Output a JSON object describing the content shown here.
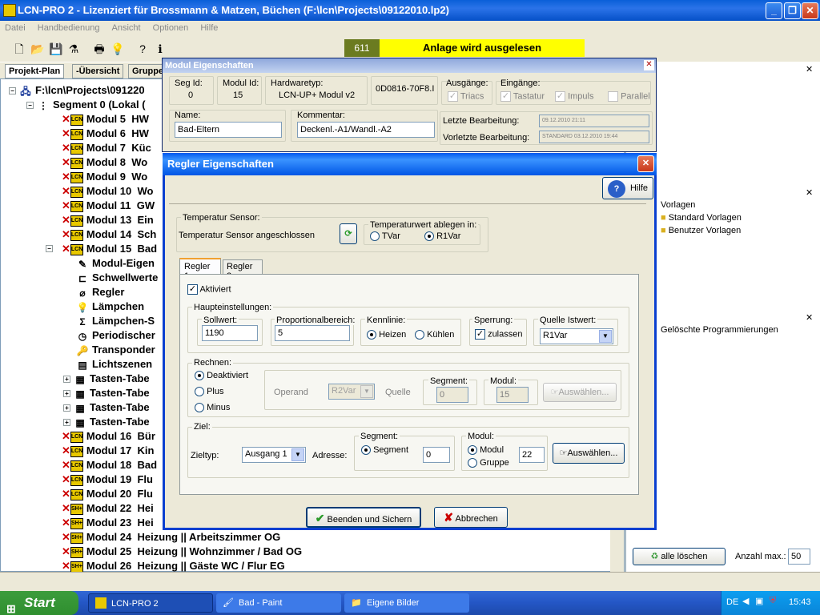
{
  "app": {
    "title": "LCN-PRO 2 - Lizenziert für Brossmann & Matzen, Büchen (F:\\lcn\\Projects\\09122010.lp2)"
  },
  "menu": [
    "Datei",
    "Handbedienung",
    "Ansicht",
    "Optionen",
    "Hilfe"
  ],
  "status": {
    "code": "611",
    "message": "Anlage wird ausgelesen"
  },
  "left_tabs": [
    "Projekt-Plan",
    "-Übersicht",
    "Gruppen"
  ],
  "tree": {
    "root": "F:\\lcn\\Projects\\091220",
    "segment": "Segment 0 (Lokal (",
    "modules_top": [
      {
        "num": "Modul 5",
        "name": "HW"
      },
      {
        "num": "Modul 6",
        "name": "HW"
      },
      {
        "num": "Modul 7",
        "name": "Küc"
      },
      {
        "num": "Modul 8",
        "name": "Wo"
      },
      {
        "num": "Modul 9",
        "name": "Wo"
      },
      {
        "num": "Modul 10",
        "name": "Wo"
      },
      {
        "num": "Modul 11",
        "name": "GW"
      },
      {
        "num": "Modul 13",
        "name": "Ein"
      },
      {
        "num": "Modul 14",
        "name": "Sch"
      },
      {
        "num": "Modul 15",
        "name": "Bad"
      }
    ],
    "children": [
      "Modul-Eigen",
      "Schwellwerte",
      "Regler",
      "Lämpchen",
      "Lämpchen-S",
      "Periodischer",
      "Transponder",
      "Lichtszenen",
      "Tasten-Tabe",
      "Tasten-Tabe",
      "Tasten-Tabe",
      "Tasten-Tabe"
    ],
    "modules_bottom": [
      {
        "num": "Modul 16",
        "name": "Bür",
        "icon": "LCN"
      },
      {
        "num": "Modul 17",
        "name": "Kin",
        "icon": "LCN"
      },
      {
        "num": "Modul 18",
        "name": "Bad",
        "icon": "LCN"
      },
      {
        "num": "Modul 19",
        "name": "Flu",
        "icon": "LCN"
      },
      {
        "num": "Modul 20",
        "name": "Flu",
        "icon": "LCN"
      },
      {
        "num": "Modul 22",
        "name": "Hei",
        "icon": "SH+"
      },
      {
        "num": "Modul 23",
        "name": "Hei",
        "icon": "SH+"
      },
      {
        "num": "Modul 24",
        "name": "Heizung || Arbeitszimmer OG",
        "icon": "SH+"
      },
      {
        "num": "Modul 25",
        "name": "Heizung || Wohnzimmer / Bad OG",
        "icon": "SH+"
      },
      {
        "num": "Modul 26",
        "name": "Heizung || Gäste WC / Flur EG",
        "icon": "SH+"
      }
    ]
  },
  "right_pane": {
    "vorlagen": "Vorlagen",
    "standard": "Standard Vorlagen",
    "benutzer": "Benutzer Vorlagen",
    "geloeschte": "Gelöschte Programmierungen",
    "alle_loeschen": "alle löschen",
    "anzahl_label": "Anzahl max.:",
    "anzahl_value": "50"
  },
  "modul_window": {
    "title": "Modul Eigenschaften",
    "seg_label": "Seg Id:",
    "seg_value": "0",
    "modul_label": "Modul Id:",
    "modul_value": "15",
    "hw_label": "Hardwaretyp:",
    "hw_value": "LCN-UP+ Modul v2",
    "serial": "0D0816-70F8.I",
    "ausgaenge": "Ausgänge:",
    "triacs": "Triacs",
    "eingaenge": "Eingänge:",
    "tastatur": "Tastatur",
    "impuls": "Impuls",
    "parallel": "Parallel",
    "name_label": "Name:",
    "name_value": "Bad-Eltern",
    "kommentar_label": "Kommentar:",
    "kommentar_value": "Deckenl.-A1/Wandl.-A2",
    "letzte_label": "Letzte Bearbeitung:",
    "letzte_value": "09.12.2010 21:11",
    "vorletzte_label": "Vorletzte Bearbeitung:",
    "vorletzte_value": "STANDARD 03.12.2010 19:44"
  },
  "dialog": {
    "title": "Regler Eigenschaften",
    "hilfe": "Hilfe",
    "sensor_group": "Temperatur Sensor:",
    "sensor_status": "Temperatur Sensor angeschlossen",
    "ablegen_group": "Temperaturwert ablegen in:",
    "tvar": "TVar",
    "r1var": "R1Var",
    "tabs": [
      "Regler 1",
      "Regler 2"
    ],
    "aktiviert": "Aktiviert",
    "haupt_group": "Haupteinstellungen:",
    "sollwert_label": "Sollwert:",
    "sollwert_value": "1190",
    "prop_label": "Proportionalbereich:",
    "prop_value": "5",
    "kennlinie_label": "Kennlinie:",
    "heizen": "Heizen",
    "kuehlen": "Kühlen",
    "sperrung_label": "Sperrung:",
    "zulassen": "zulassen",
    "quelle_label": "Quelle Istwert:",
    "quelle_value": "R1Var",
    "rechnen_group": "Rechnen:",
    "deaktiviert": "Deaktiviert",
    "plus": "Plus",
    "minus": "Minus",
    "operand_label": "Operand",
    "operand_value": "R2Var",
    "quelle2_label": "Quelle",
    "segment_label": "Segment:",
    "segment_value": "0",
    "modul_label": "Modul:",
    "modul_value": "15",
    "auswaehlen": "Auswählen...",
    "ziel_group": "Ziel:",
    "zieltyp_label": "Zieltyp:",
    "zieltyp_value": "Ausgang 1",
    "adresse_label": "Adresse:",
    "ziel_segment_group": "Segment:",
    "ziel_segment_radio": "Segment",
    "ziel_segment_value": "0",
    "ziel_modul_group": "Modul:",
    "ziel_modul_radio": "Modul",
    "ziel_gruppe_radio": "Gruppe",
    "ziel_modul_value": "22",
    "ziel_auswaehlen": "Auswählen...",
    "beenden": "Beenden und Sichern",
    "abbrechen": "Abbrechen"
  },
  "taskbar": {
    "start": "Start",
    "items": [
      "LCN-PRO 2",
      "Bad - Paint",
      "Eigene Bilder"
    ],
    "lang": "DE",
    "time": "15:43"
  }
}
